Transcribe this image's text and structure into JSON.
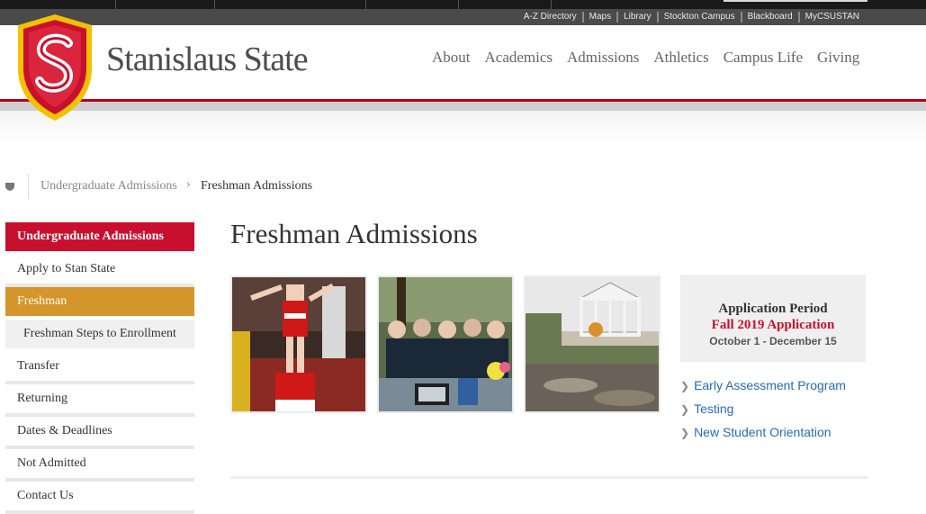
{
  "colors": {
    "accent_red": "#c8102e",
    "accent_gold": "#d4952a",
    "link_blue": "#2a6ab0",
    "utility_bar": "#4a4a4a"
  },
  "utility_links": [
    "A-Z Directory",
    "Maps",
    "Library",
    "Stockton Campus",
    "Blackboard",
    "MyCSUSTAN"
  ],
  "header": {
    "logo_icon": "university-shield-logo",
    "wordmark": "Stanislaus State",
    "nav": [
      "About",
      "Academics",
      "Admissions",
      "Athletics",
      "Campus Life",
      "Giving"
    ]
  },
  "breadcrumb": {
    "home_icon": "home-icon",
    "items": [
      "Undergraduate Admissions",
      "Freshman Admissions"
    ],
    "separator": "›"
  },
  "sidebar": {
    "items": [
      {
        "label": "Undergraduate Admissions"
      },
      {
        "label": "Apply to Stan State"
      },
      {
        "label": "Freshman"
      },
      {
        "label": "Freshman Steps to Enrollment"
      },
      {
        "label": "Transfer"
      },
      {
        "label": "Returning"
      },
      {
        "label": "Dates & Deadlines"
      },
      {
        "label": "Not Admitted"
      },
      {
        "label": "Contact Us"
      }
    ]
  },
  "main": {
    "title": "Freshman Admissions",
    "photos": [
      "cheerleaders-photo",
      "students-at-table-photo",
      "campus-gazebo-photo"
    ],
    "info_box": {
      "heading": "Application Period",
      "subheading": "Fall 2019 Application",
      "dates": "October 1 - December 15"
    },
    "links": [
      "Early Assessment Program",
      "Testing",
      "New Student Orientation"
    ]
  }
}
